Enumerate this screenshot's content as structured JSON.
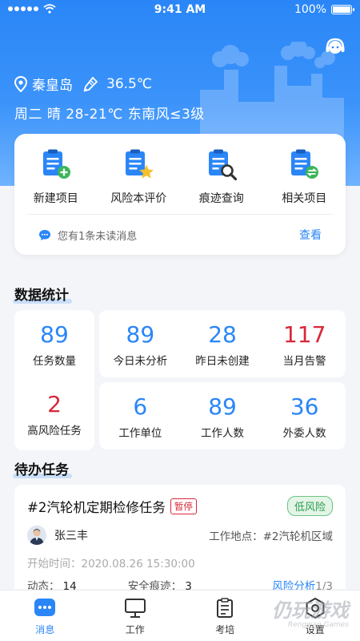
{
  "status_bar": {
    "time": "9:41 AM",
    "battery": "100%"
  },
  "header": {
    "city": "秦皇岛",
    "temperature": "36.5℃",
    "weather": "周二  晴 28-21℃ 东南风≤3级"
  },
  "quick_actions": [
    {
      "label": "新建项目",
      "icon": "new-project-icon"
    },
    {
      "label": "风险本评价",
      "icon": "risk-evaluation-icon"
    },
    {
      "label": "痕迹查询",
      "icon": "trace-search-icon"
    },
    {
      "label": "相关项目",
      "icon": "related-project-icon"
    }
  ],
  "message": {
    "text": "您有1条未读消息",
    "link": "查看"
  },
  "stats": {
    "title": "数据统计",
    "items": [
      {
        "value": "89",
        "label": "任务数量"
      },
      {
        "value": "2",
        "label": "高风险任务"
      },
      {
        "value": "89",
        "label": "今日未分析"
      },
      {
        "value": "28",
        "label": "昨日未创建"
      },
      {
        "value": "117",
        "label": "当月告警"
      },
      {
        "value": "6",
        "label": "工作单位"
      },
      {
        "value": "89",
        "label": "工作人数"
      },
      {
        "value": "36",
        "label": "外委人数"
      }
    ]
  },
  "todo": {
    "title": "待办任务",
    "task": {
      "title": "#2汽轮机定期检修任务",
      "status_tag": "暂停",
      "risk_tag": "低风险",
      "person": "张三丰",
      "site_label": "工作地点：",
      "site": "#2汽轮机区域",
      "start_label": "开始时间：",
      "start_time": "2020.08.26  15:30:00",
      "dynamics_label": "动态：",
      "dynamics": "14",
      "trace_label": "安全痕迹：",
      "trace": "3",
      "analysis_link": "风险分析",
      "page": "1/3"
    }
  },
  "tabs": [
    {
      "label": "消息",
      "icon": "message-icon",
      "active": true
    },
    {
      "label": "工作",
      "icon": "monitor-icon",
      "active": false
    },
    {
      "label": "考培",
      "icon": "clipboard-icon",
      "active": false
    },
    {
      "label": "设置",
      "icon": "gear-icon",
      "active": false
    }
  ],
  "watermark": {
    "text": "仍玩游戏",
    "sub": "Rengwan Games"
  },
  "colors": {
    "primary": "#2a86f7",
    "alert": "#d9283a",
    "safe": "#2e9b4e"
  }
}
